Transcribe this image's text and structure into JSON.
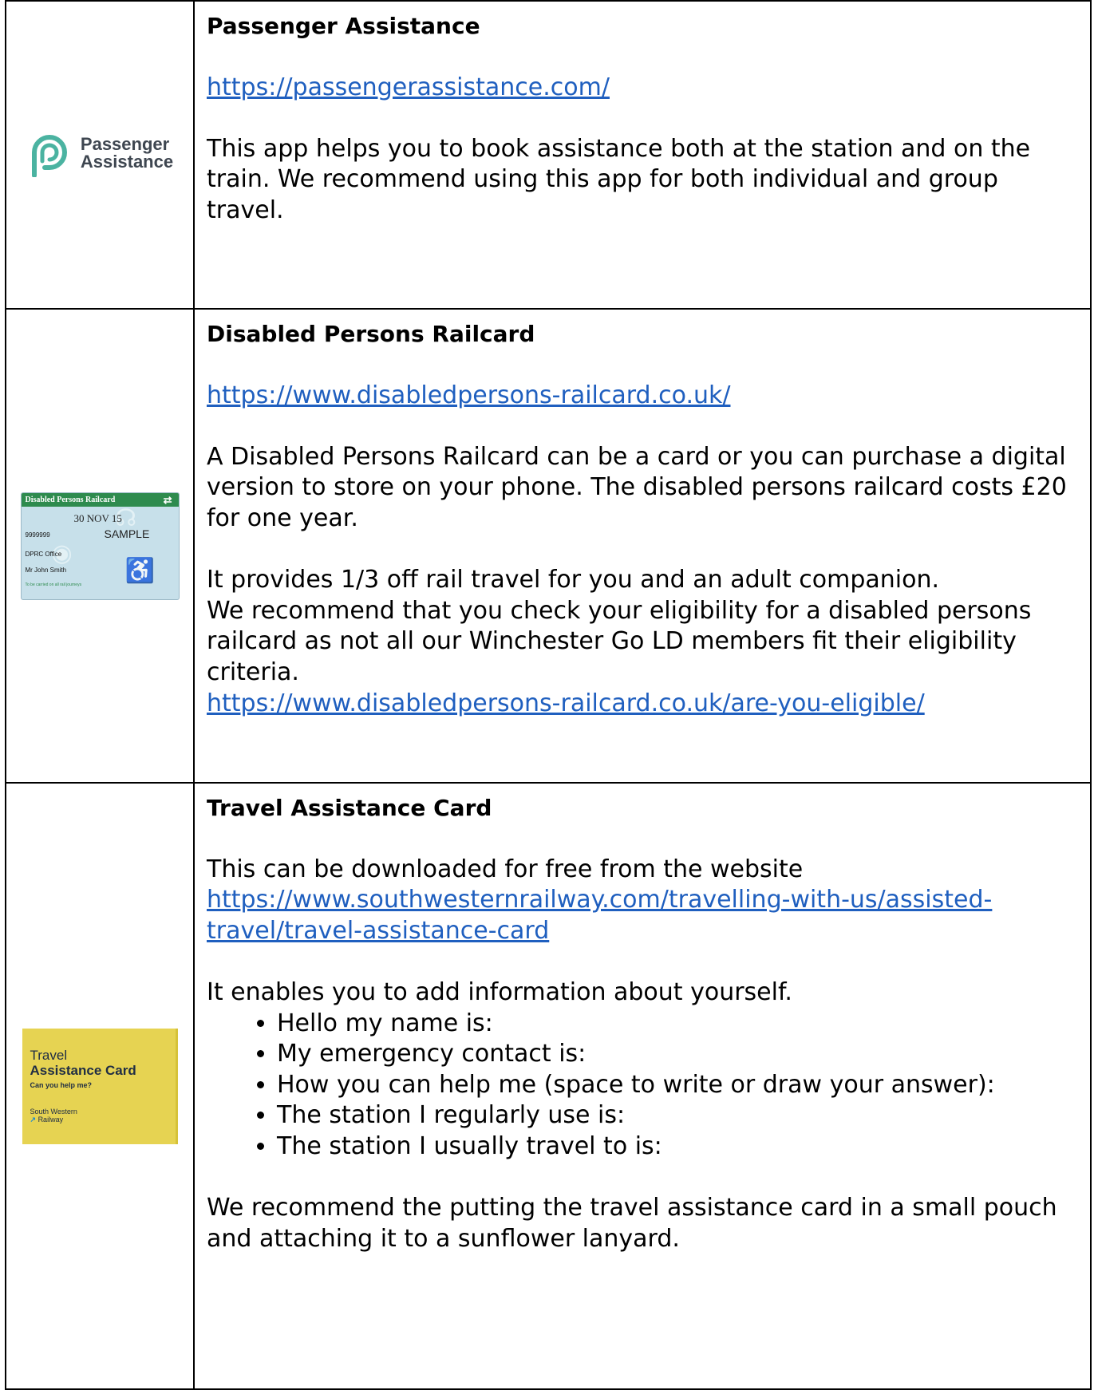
{
  "rows": [
    {
      "title": "Passenger Assistance",
      "link": "https://passengerassistance.com/",
      "body": "This app helps you to book assistance both at the station and on the train. We recommend using this app for both individual and group travel.",
      "logo": {
        "line1": "Passenger",
        "line2": "Assistance",
        "icon": "passenger-assistance-logo-icon",
        "color": "#4bb3a1"
      }
    },
    {
      "title": "Disabled Persons Railcard",
      "link": "https://www.disabledpersons-railcard.co.uk/",
      "body1": "A Disabled Persons Railcard can be a card or you can purchase a digital version to store on your phone. The disabled persons railcard costs £20 for one year.",
      "body2": "It provides 1/3 off rail travel for you and an adult companion.",
      "body3": "We recommend that you check your eligibility for a disabled persons railcard as not all our Winchester Go LD members fit their eligibility criteria.",
      "link2": "https://www.disabledpersons-railcard.co.uk/are-you-eligible/",
      "card": {
        "header": "Disabled Persons Railcard",
        "rail_symbol": "⇄",
        "valid_until_label": "Valid until",
        "date": "30 NOV 15",
        "sample": "SAMPLE",
        "number_label": "Railcard Number",
        "number": "9999999",
        "issued_label": "Issued at",
        "office": "DPRC Office",
        "issued_to_label": "Issued to",
        "name": "Mr John Smith",
        "footer": "To be carried on all rail journeys",
        "header_color": "#2e8b4e",
        "body_color": "#c7e0ea"
      }
    },
    {
      "title": "Travel Assistance Card",
      "intro": "This can be downloaded for free from the website",
      "link": "https://www.southwesternrailway.com/travelling-with-us/assisted-travel/travel-assistance-card",
      "link_line1": "https://www.southwesternrailway.com/travelling-with-us/assisted-",
      "link_line2": "travel/travel-assistance-card",
      "body1": "It enables you to add information about yourself.",
      "bullets": [
        "Hello my name is:",
        "My emergency contact is:",
        "How you can help me (space to write or draw your answer):",
        "The station I regularly use is:",
        "The station I usually travel to is:"
      ],
      "body2": "We recommend the putting the travel assistance card in a small pouch and attaching it to a sunflower lanyard.",
      "card": {
        "title1": "Travel",
        "title2": "Assistance Card",
        "subtitle": "Can you help me?",
        "brand1": "South Western",
        "brand2": "Railway",
        "brand_arrow": "↗",
        "color": "#e6d352"
      }
    }
  ],
  "colors": {
    "link": "#1f5fbf",
    "border": "#000000"
  }
}
